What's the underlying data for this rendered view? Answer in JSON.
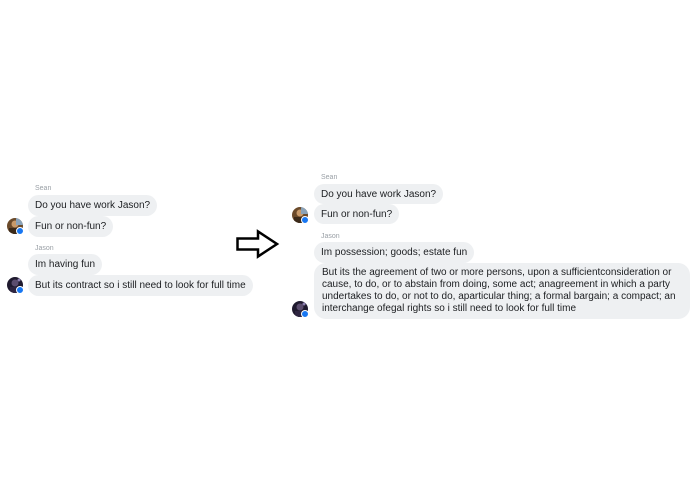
{
  "left_chat": {
    "sean": {
      "name": "Sean",
      "messages": [
        "Do you have work Jason?",
        "Fun or non-fun?"
      ]
    },
    "jason": {
      "name": "Jason",
      "messages": [
        "Im having fun",
        "But its contract so i still need to look for full time"
      ]
    }
  },
  "right_chat": {
    "sean": {
      "name": "Sean",
      "messages": [
        "Do you have work Jason?",
        "Fun or non-fun?"
      ]
    },
    "jason": {
      "name": "Jason",
      "messages": [
        "Im possession; goods; estate fun",
        "But its the agreement of two or more persons, upon a sufficientconsideration or cause, to do, or to abstain from doing, some act; anagreement in which a party undertakes to do, or not to do, aparticular thing; a formal bargain; a compact; an interchange ofegal rights so i still need to look for full time"
      ]
    }
  },
  "colors": {
    "bubble": "#eef0f2",
    "online_dot": "#1877f2",
    "sender_label": "#9aa0a6"
  },
  "icons": {
    "arrow": "right-arrow-icon"
  }
}
